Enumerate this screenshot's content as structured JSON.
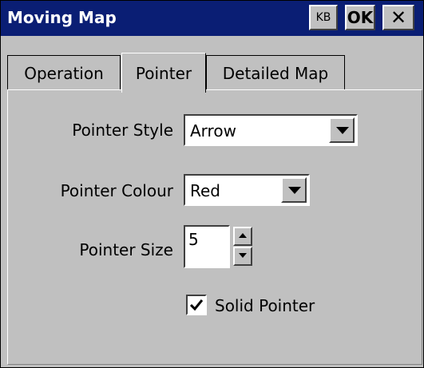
{
  "window": {
    "title": "Moving Map",
    "kb_label": "KB",
    "ok_label": "OK",
    "close_label": "✕"
  },
  "tabs": [
    {
      "label": "Operation",
      "active": false
    },
    {
      "label": "Pointer",
      "active": true
    },
    {
      "label": "Detailed Map",
      "active": false
    }
  ],
  "form": {
    "pointer_style": {
      "label": "Pointer Style",
      "value": "Arrow"
    },
    "pointer_colour": {
      "label": "Pointer Colour",
      "value": "Red"
    },
    "pointer_size": {
      "label": "Pointer Size",
      "value": "5"
    },
    "solid_pointer": {
      "label": "Solid Pointer",
      "checked": true
    }
  },
  "colors": {
    "title_bar": "#0a1e74",
    "face": "#c0c0c0"
  },
  "icons": {
    "dropdown": "chevron-down-icon",
    "spin_up": "arrow-up-icon",
    "spin_down": "arrow-down-icon",
    "check": "checkmark-icon"
  }
}
